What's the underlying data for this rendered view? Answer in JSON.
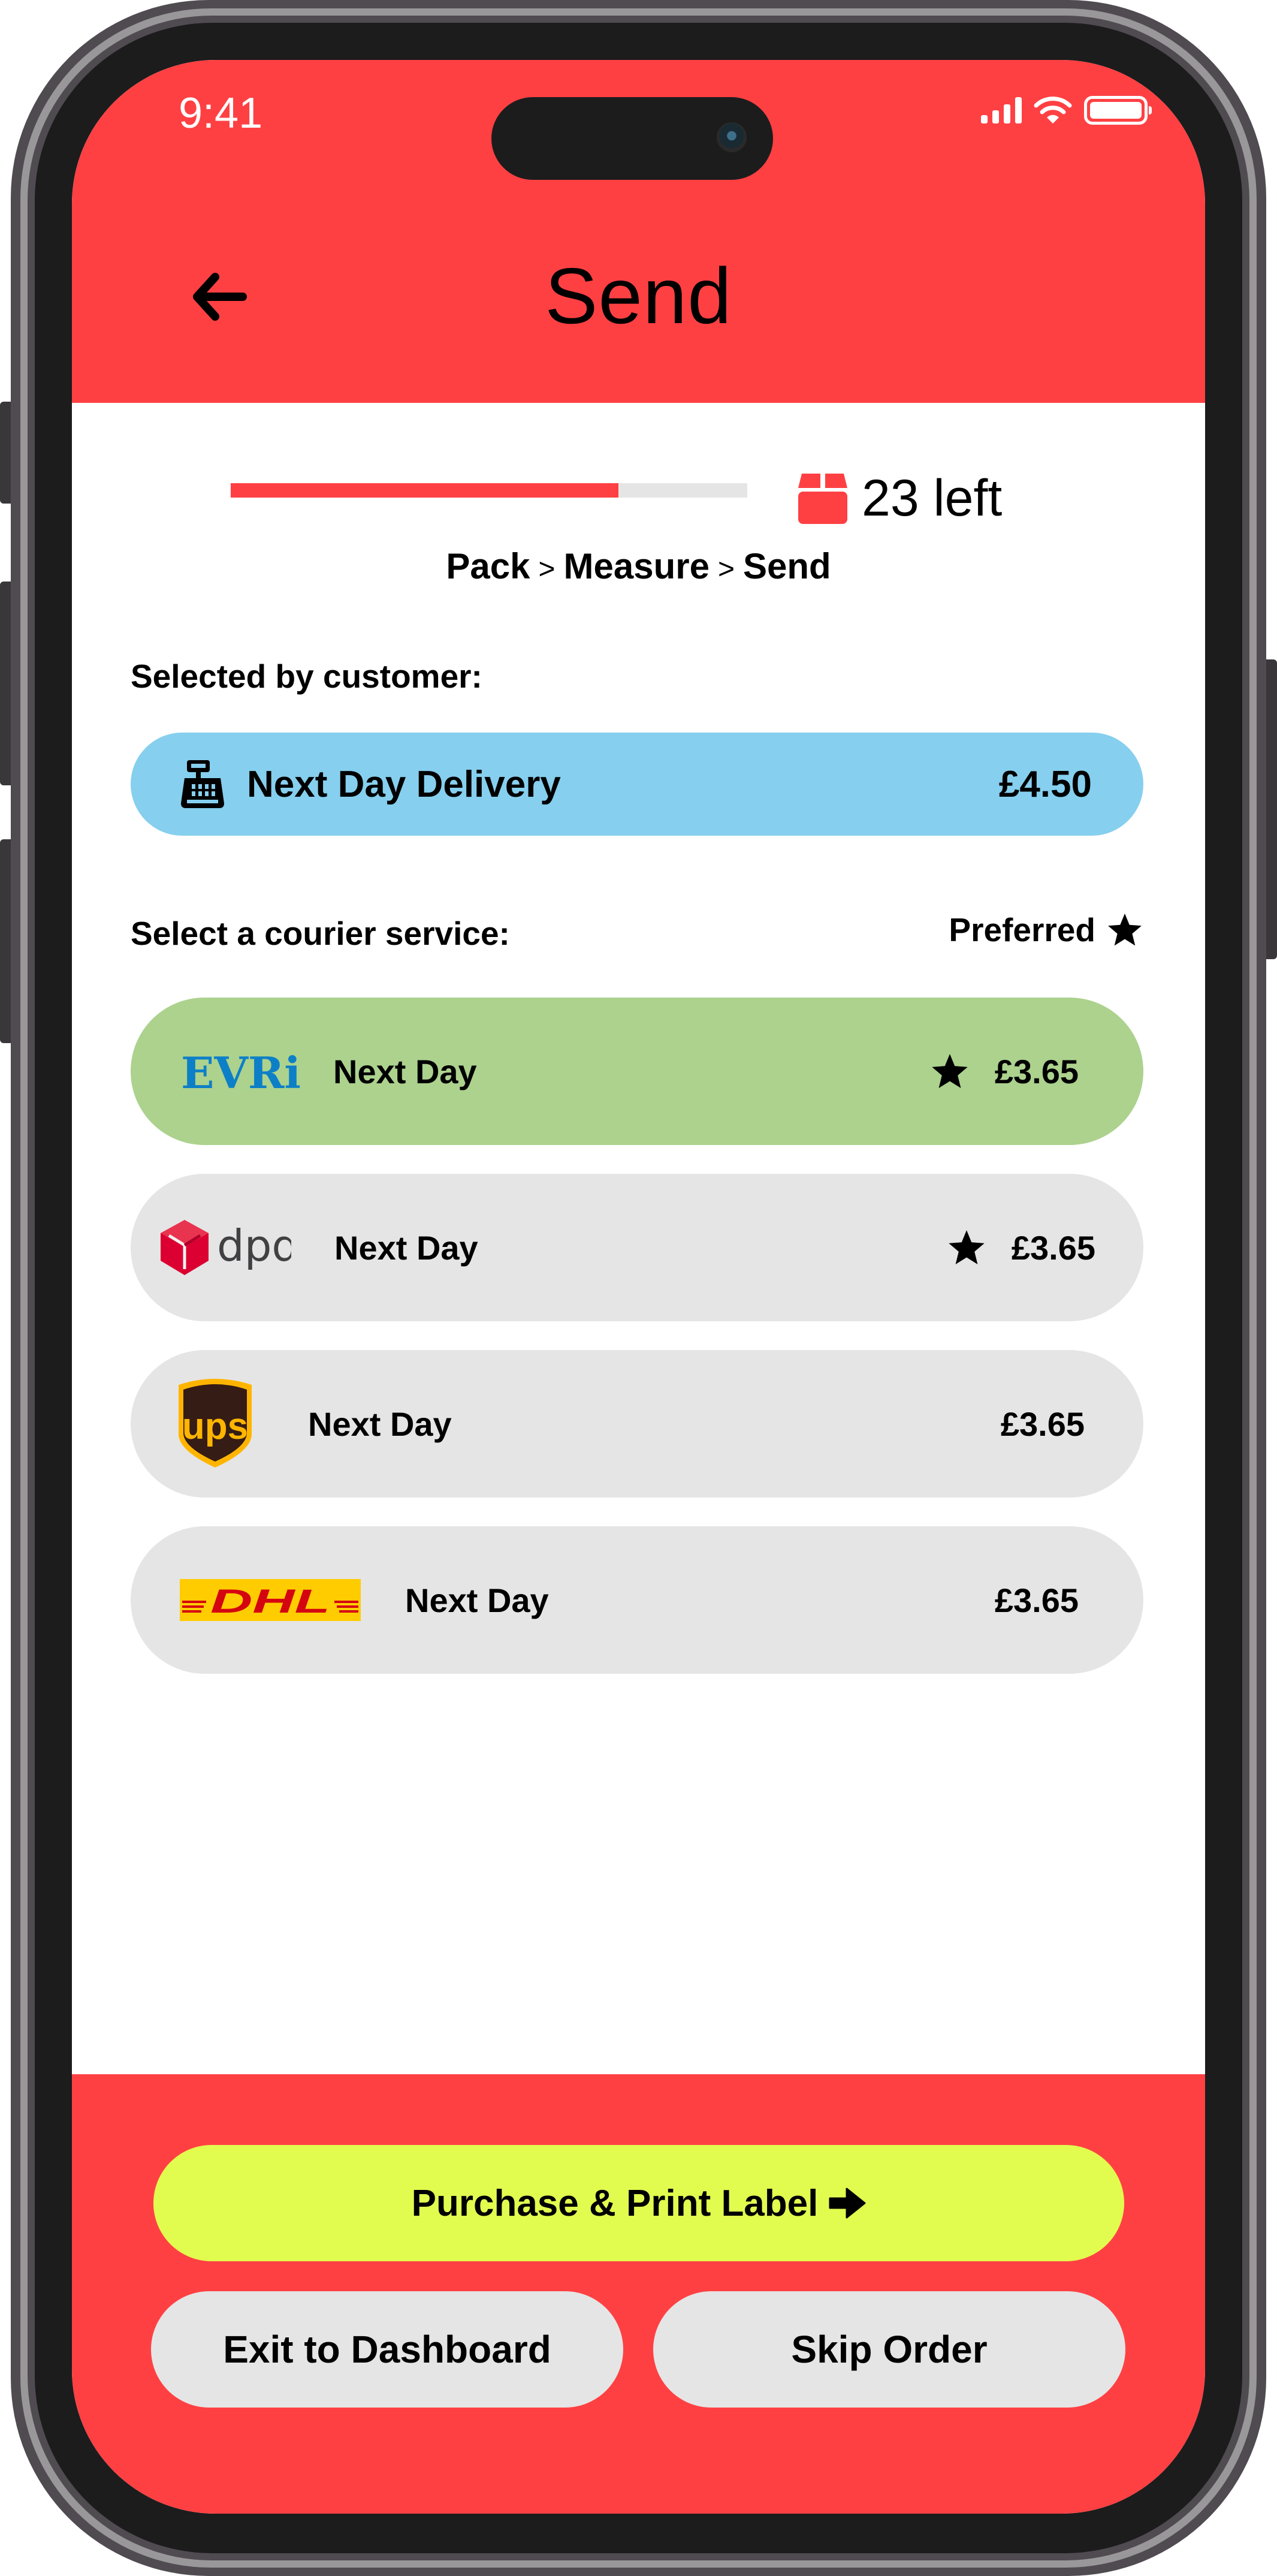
{
  "status_bar": {
    "time": "9:41",
    "icons": [
      "cellular-signal-icon",
      "wifi-icon",
      "battery-icon"
    ]
  },
  "header": {
    "title": "Send",
    "back_icon": "arrow-left-icon"
  },
  "progress": {
    "fraction_complete": 0.75,
    "remaining_icon": "package-icon",
    "remaining_label": "23 left"
  },
  "breadcrumb": {
    "steps": [
      "Pack",
      "Measure",
      "Send"
    ],
    "separator": ">"
  },
  "customer_selection": {
    "label": "Selected by customer:",
    "icon": "cash-register-icon",
    "service": "Next Day Delivery",
    "price": "£4.50"
  },
  "courier_section": {
    "label": "Select a courier service:",
    "preferred_label": "Preferred",
    "preferred_icon": "star-icon"
  },
  "couriers": [
    {
      "brand": "EVRi",
      "logo": "evri-logo",
      "service": "Next Day",
      "price": "£3.65",
      "preferred": true,
      "selected": true
    },
    {
      "brand": "dpd",
      "logo": "dpd-logo",
      "service": "Next Day",
      "price": "£3.65",
      "preferred": true,
      "selected": false
    },
    {
      "brand": "ups",
      "logo": "ups-logo",
      "service": "Next Day",
      "price": "£3.65",
      "preferred": false,
      "selected": false
    },
    {
      "brand": "DHL",
      "logo": "dhl-logo",
      "service": "Next Day",
      "price": "£3.65",
      "preferred": false,
      "selected": false
    }
  ],
  "footer": {
    "primary_label": "Purchase & Print Label",
    "primary_icon": "arrow-right-icon",
    "exit_label": "Exit to Dashboard",
    "skip_label": "Skip Order"
  },
  "colors": {
    "brand_red": "#ff4043",
    "customer_pill": "#86cfee",
    "selected_courier": "#acd28e",
    "unselected_courier": "#e5e5e5",
    "primary_button": "#e2fb4f",
    "evri_blue": "#0d7fc7",
    "dpd_red": "#dc0032",
    "ups_brown": "#351c15",
    "ups_gold": "#ffb500",
    "dhl_yellow": "#ffcc00",
    "dhl_red": "#d40511"
  }
}
